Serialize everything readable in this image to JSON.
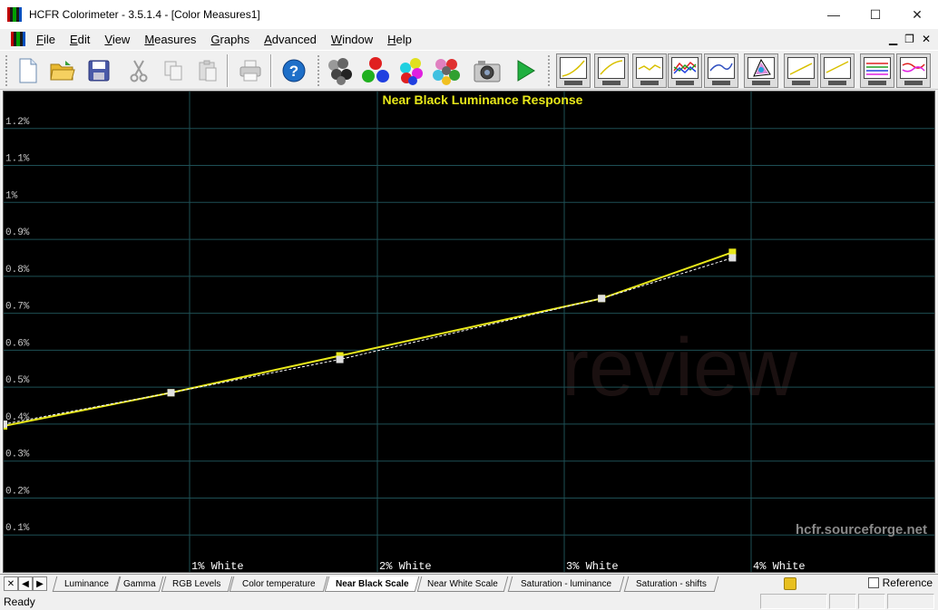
{
  "window": {
    "title": "HCFR Colorimeter - 3.5.1.4 - [Color Measures1]",
    "minimize": "—",
    "maximize": "☐",
    "close": "✕"
  },
  "menu": {
    "items": [
      {
        "label": "File",
        "key": "F"
      },
      {
        "label": "Edit",
        "key": "E"
      },
      {
        "label": "View",
        "key": "V"
      },
      {
        "label": "Measures",
        "key": "M"
      },
      {
        "label": "Graphs",
        "key": "G"
      },
      {
        "label": "Advanced",
        "key": "A"
      },
      {
        "label": "Window",
        "key": "W"
      },
      {
        "label": "Help",
        "key": "H"
      }
    ],
    "mdi_minimize": "▁",
    "mdi_restore": "❐",
    "mdi_close": "✕"
  },
  "toolbar": {
    "buttons": [
      "new-document-icon",
      "open-folder-icon",
      "save-disk-icon",
      "cut-scissors-icon",
      "copy-icon",
      "paste-icon",
      "print-icon",
      "help-icon",
      "measure-grayscale-icon",
      "measure-primaries-icon",
      "measure-secondaries-icon",
      "measure-saturation-icon",
      "camera-icon",
      "play-icon"
    ],
    "graph_buttons": [
      "luminance-graph-icon",
      "gamma-graph-icon",
      "rgb-levels-graph-icon",
      "color-temperature-graph-icon",
      "cie-diagram-graph-icon",
      "cie-chart-graph-icon",
      "near-black-graph-icon",
      "near-white-graph-icon",
      "saturation-luminance-graph-icon",
      "saturation-shifts-graph-icon"
    ]
  },
  "chart_data": {
    "type": "line",
    "title": "Near Black Luminance Response",
    "x_categories": [
      "",
      "1% White",
      "2% White",
      "3% White",
      "4% White"
    ],
    "xlim": [
      0,
      4
    ],
    "ylim": [
      0,
      1.3
    ],
    "y_ticks": [
      "0.1%",
      "0.2%",
      "0.3%",
      "0.4%",
      "0.5%",
      "0.6%",
      "0.7%",
      "0.8%",
      "0.9%",
      "1%",
      "1.1%",
      "1.2%"
    ],
    "y_tick_values": [
      0.1,
      0.2,
      0.3,
      0.4,
      0.5,
      0.6,
      0.7,
      0.8,
      0.9,
      1.0,
      1.1,
      1.2
    ],
    "grid": true,
    "series": [
      {
        "color": "#e8e81a",
        "style": "solid",
        "x": [
          0,
          0.9,
          1.8,
          3.2,
          3.9
        ],
        "y": [
          0.395,
          0.485,
          0.585,
          0.74,
          0.865
        ]
      },
      {
        "color": "#ffffff",
        "style": "dashed",
        "x": [
          0,
          0.9,
          1.8,
          3.2,
          3.9
        ],
        "y": [
          0.4,
          0.485,
          0.575,
          0.74,
          0.85
        ]
      }
    ],
    "watermark": "hcfr.sourceforge.net",
    "background_watermark": "review"
  },
  "tabs": {
    "items": [
      "Luminance",
      "Gamma",
      "RGB Levels",
      "Color temperature",
      "Near Black Scale",
      "Near White Scale",
      "Saturation - luminance",
      "Saturation - shifts"
    ],
    "active_index": 4,
    "reference_label": "Reference"
  },
  "status": {
    "text": "Ready"
  }
}
